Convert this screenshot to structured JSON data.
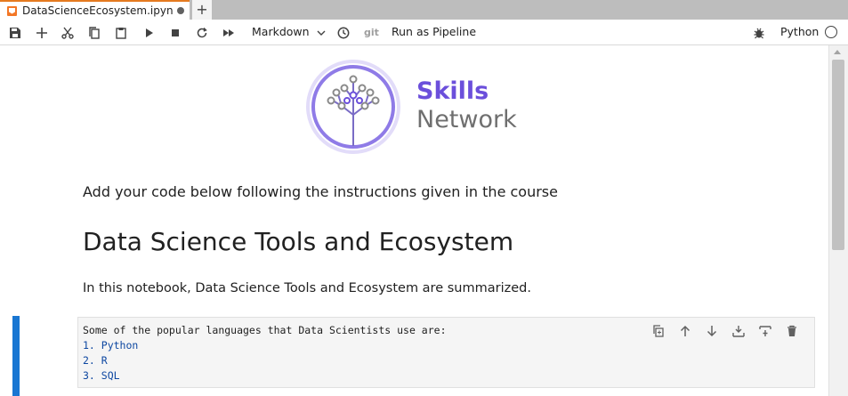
{
  "tab": {
    "title": "DataScienceEcosystem.ipyn",
    "add_label": "+"
  },
  "toolbar": {
    "cell_type": "Markdown",
    "git_label": "git",
    "run_pipeline": "Run as Pipeline",
    "kernel_name": "Python"
  },
  "logo": {
    "line1": "Skills",
    "line2": "Network",
    "ring_color": "#8f7be7",
    "accent_color": "#6b4fdb"
  },
  "notebook": {
    "intro": "Add your code below following the instructions given in the course",
    "heading": "Data Science Tools and Ecosystem",
    "paragraph": "In this notebook, Data Science Tools and Ecosystem are summarized.",
    "cell": {
      "line1": "Some of the popular languages that Data Scientists use are:",
      "items": [
        "1. Python",
        "2. R",
        "3. SQL"
      ]
    }
  },
  "colors": {
    "active_cell": "#1976d2",
    "tab_accent": "#e57a20"
  }
}
